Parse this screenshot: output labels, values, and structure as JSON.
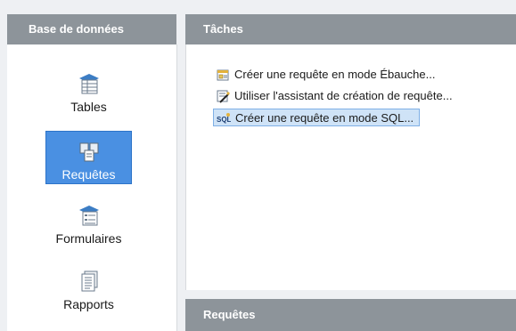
{
  "sidebar": {
    "header": "Base de données",
    "items": [
      {
        "label": "Tables",
        "icon": "table-icon",
        "selected": false
      },
      {
        "label": "Requêtes",
        "icon": "query-icon",
        "selected": true
      },
      {
        "label": "Formulaires",
        "icon": "form-icon",
        "selected": false
      },
      {
        "label": "Rapports",
        "icon": "report-icon",
        "selected": false
      }
    ]
  },
  "tasks": {
    "header": "Tâches",
    "items": [
      {
        "label": "Créer une requête en mode Ébauche...",
        "icon": "design-view-icon",
        "selected": false
      },
      {
        "label": "Utiliser l'assistant de création de requête...",
        "icon": "wizard-icon",
        "selected": false
      },
      {
        "label": "Créer une requête en mode SQL...",
        "icon": "sql-icon",
        "selected": true
      }
    ]
  },
  "queries": {
    "header": "Requêtes"
  },
  "colors": {
    "header_bg": "#8d949a",
    "selection": "#4a90e2",
    "task_selection": "#cfe3f7"
  }
}
